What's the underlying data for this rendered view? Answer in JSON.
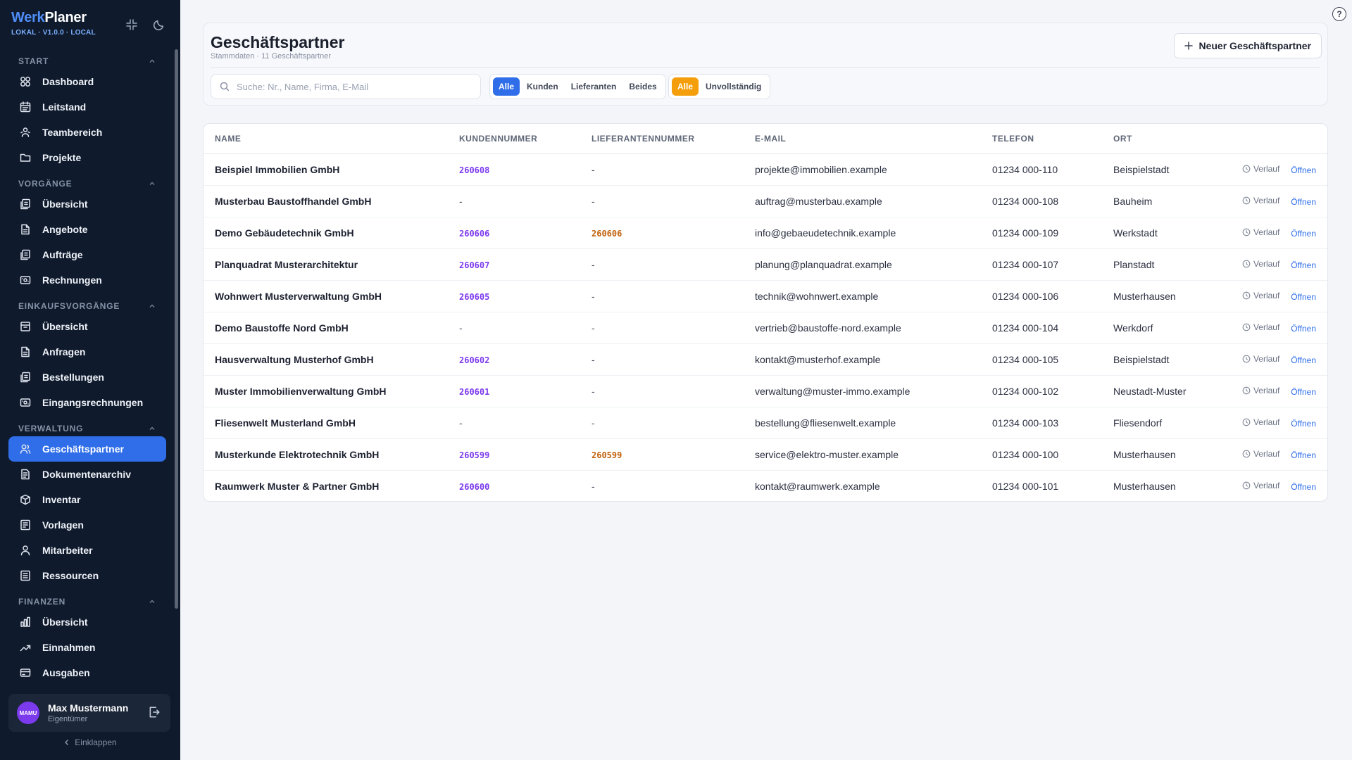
{
  "app": {
    "name_part1": "Werk",
    "name_part2": "Planer",
    "version": "LOKAL · V1.0.0 · LOCAL"
  },
  "sidebar": {
    "sections": [
      {
        "title": "START",
        "items": [
          "Dashboard",
          "Leitstand",
          "Teambereich",
          "Projekte"
        ]
      },
      {
        "title": "VORGÄNGE",
        "items": [
          "Übersicht",
          "Angebote",
          "Aufträge",
          "Rechnungen"
        ]
      },
      {
        "title": "EINKAUFSVORGÄNGE",
        "items": [
          "Übersicht",
          "Anfragen",
          "Bestellungen",
          "Eingangsrechnungen"
        ]
      },
      {
        "title": "VERWALTUNG",
        "items": [
          "Geschäftspartner",
          "Dokumentenarchiv",
          "Inventar",
          "Vorlagen",
          "Mitarbeiter",
          "Ressourcen"
        ]
      },
      {
        "title": "FINANZEN",
        "items": [
          "Übersicht",
          "Einnahmen",
          "Ausgaben"
        ]
      }
    ],
    "active_item": "Geschäftspartner",
    "user": {
      "initials": "MAMU",
      "name": "Max Mustermann",
      "role": "Eigentümer"
    },
    "collapse_label": "Einklappen"
  },
  "header": {
    "title": "Geschäftspartner",
    "subtitle": "Stammdaten · 11 Geschäftspartner",
    "new_button": "Neuer Geschäftspartner",
    "search_placeholder": "Suche: Nr., Name, Firma, E-Mail",
    "type_filter": [
      "Alle",
      "Kunden",
      "Lieferanten",
      "Beides"
    ],
    "status_filter": [
      "Alle",
      "Unvollständig"
    ]
  },
  "table": {
    "columns": [
      "NAME",
      "KUNDENNUMMER",
      "LIEFERANTENNUMMER",
      "E-MAIL",
      "TELEFON",
      "ORT"
    ],
    "history_label": "Verlauf",
    "open_label": "Öffnen",
    "rows": [
      {
        "name": "Beispiel Immobilien GmbH",
        "customer": "260608",
        "supplier": "-",
        "email": "projekte@immobilien.example",
        "phone": "01234 000-110",
        "city": "Beispielstadt"
      },
      {
        "name": "Musterbau Baustoffhandel GmbH",
        "customer": "-",
        "supplier": "-",
        "email": "auftrag@musterbau.example",
        "phone": "01234 000-108",
        "city": "Bauheim"
      },
      {
        "name": "Demo Gebäudetechnik GmbH",
        "customer": "260606",
        "supplier": "260606",
        "email": "info@gebaeudetechnik.example",
        "phone": "01234 000-109",
        "city": "Werkstadt"
      },
      {
        "name": "Planquadrat Musterarchitektur",
        "customer": "260607",
        "supplier": "-",
        "email": "planung@planquadrat.example",
        "phone": "01234 000-107",
        "city": "Planstadt"
      },
      {
        "name": "Wohnwert Musterverwaltung GmbH",
        "customer": "260605",
        "supplier": "-",
        "email": "technik@wohnwert.example",
        "phone": "01234 000-106",
        "city": "Musterhausen"
      },
      {
        "name": "Demo Baustoffe Nord GmbH",
        "customer": "-",
        "supplier": "-",
        "email": "vertrieb@baustoffe-nord.example",
        "phone": "01234 000-104",
        "city": "Werkdorf"
      },
      {
        "name": "Hausverwaltung Musterhof GmbH",
        "customer": "260602",
        "supplier": "-",
        "email": "kontakt@musterhof.example",
        "phone": "01234 000-105",
        "city": "Beispielstadt"
      },
      {
        "name": "Muster Immobilienverwaltung GmbH",
        "customer": "260601",
        "supplier": "-",
        "email": "verwaltung@muster-immo.example",
        "phone": "01234 000-102",
        "city": "Neustadt-Muster"
      },
      {
        "name": "Fliesenwelt Musterland GmbH",
        "customer": "-",
        "supplier": "-",
        "email": "bestellung@fliesenwelt.example",
        "phone": "01234 000-103",
        "city": "Fliesendorf"
      },
      {
        "name": "Musterkunde Elektrotechnik GmbH",
        "customer": "260599",
        "supplier": "260599",
        "email": "service@elektro-muster.example",
        "phone": "01234 000-100",
        "city": "Musterhausen"
      },
      {
        "name": "Raumwerk Muster & Partner GmbH",
        "customer": "260600",
        "supplier": "-",
        "email": "kontakt@raumwerk.example",
        "phone": "01234 000-101",
        "city": "Musterhausen"
      }
    ]
  },
  "colors": {
    "accent": "#2f6ee8",
    "warning": "#f59e0b",
    "customer_number": "#7c3aed",
    "supplier_number": "#c2610c",
    "sidebar_bg": "#0f1a2c"
  }
}
